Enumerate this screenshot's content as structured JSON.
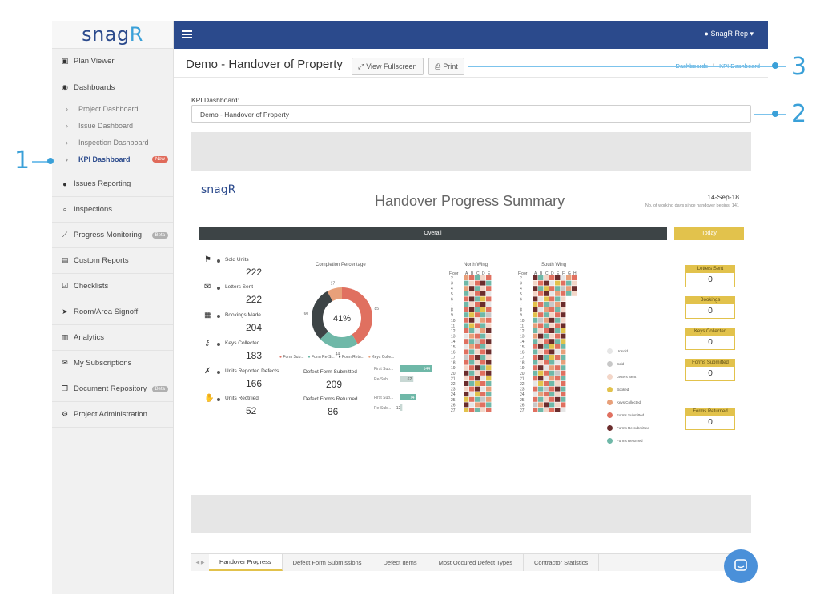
{
  "sidebar": {
    "logo_main": "snag",
    "logo_accent": "R",
    "items": [
      {
        "icon": "plan-viewer-icon",
        "label": "Plan Viewer"
      },
      {
        "icon": "dashboards-icon",
        "label": "Dashboards"
      },
      {
        "icon": "pin-icon",
        "label": "Issues Reporting"
      },
      {
        "icon": "search-icon",
        "label": "Inspections"
      },
      {
        "icon": "chart-line-icon",
        "label": "Progress Monitoring",
        "badge": "Beta"
      },
      {
        "icon": "document-icon",
        "label": "Custom Reports"
      },
      {
        "icon": "checkbox-icon",
        "label": "Checklists"
      },
      {
        "icon": "send-icon",
        "label": "Room/Area Signoff"
      },
      {
        "icon": "bar-chart-icon",
        "label": "Analytics"
      },
      {
        "icon": "envelope-icon",
        "label": "My Subscriptions"
      },
      {
        "icon": "files-icon",
        "label": "Document Repository",
        "badge": "Beta"
      },
      {
        "icon": "gears-icon",
        "label": "Project Administration"
      }
    ],
    "dashboard_sub": [
      {
        "label": "Project Dashboard"
      },
      {
        "label": "Issue Dashboard"
      },
      {
        "label": "Inspection Dashboard"
      },
      {
        "label": "KPI Dashboard",
        "badge": "New"
      }
    ]
  },
  "topbar": {
    "user": "SnagR Rep"
  },
  "header": {
    "title": "Demo - Handover of Property",
    "fullscreen_label": "View Fullscreen",
    "print_label": "Print",
    "breadcrumb": [
      "Dashboards",
      "KPI Dashboard"
    ]
  },
  "kpi": {
    "label": "KPI Dashboard:",
    "selected": "Demo - Handover of Property"
  },
  "report": {
    "logo": "snagR",
    "title": "Handover Progress Summary",
    "date": "14-Sep-18",
    "days_label": "No. of working days since handover begins: 141",
    "overall_label": "Overall",
    "today_label": "Today",
    "stats": [
      {
        "icon": "flag-icon",
        "label": "Sold Units",
        "value": "222"
      },
      {
        "icon": "envelope-icon",
        "label": "Letters Sent",
        "value": "222"
      },
      {
        "icon": "calendar-icon",
        "label": "Bookings Made",
        "value": "204"
      },
      {
        "icon": "key-icon",
        "label": "Keys Collected",
        "value": "183"
      },
      {
        "icon": "tools-icon",
        "label": "Units Reported Defects",
        "value": "166"
      },
      {
        "icon": "thumbs-up-icon",
        "label": "Units Rectified",
        "value": "52"
      }
    ],
    "donut": {
      "title": "Completion Percentage",
      "center": "41%",
      "segments": [
        {
          "name": "Form Sub...",
          "value": 85,
          "color": "#e07060"
        },
        {
          "name": "Form Re-S...",
          "value": 44,
          "color": "#6fb8a8"
        },
        {
          "name": "Form Retu...",
          "value": 60,
          "color": "#3d4446"
        },
        {
          "name": "Keys Colle...",
          "value": 17,
          "color": "#e8a07a"
        }
      ]
    },
    "defects_submitted": {
      "label": "Defect Form Submitted",
      "value": "209",
      "bars": [
        {
          "name": "First Sub...",
          "value": 144
        },
        {
          "name": "Re-Sub...",
          "value": 62
        }
      ]
    },
    "defects_returned": {
      "label": "Defect Forms Returned",
      "value": "86",
      "bars": [
        {
          "name": "First Sub...",
          "value": 74
        },
        {
          "name": "Re-Sub...",
          "value": 12
        }
      ]
    },
    "north_wing": {
      "title": "North Wing",
      "floor_label": "Floor",
      "cols": [
        "A",
        "B",
        "C",
        "D",
        "E"
      ]
    },
    "south_wing": {
      "title": "South Wing",
      "floor_label": "Floor",
      "cols": [
        "A",
        "B",
        "C",
        "D",
        "E",
        "F",
        "G",
        "H"
      ]
    },
    "floors": [
      "2",
      "3",
      "4",
      "5",
      "6",
      "7",
      "8",
      "9",
      "10",
      "11",
      "12",
      "13",
      "14",
      "15",
      "16",
      "17",
      "18",
      "19",
      "20",
      "21",
      "22",
      "23",
      "24",
      "25",
      "26",
      "27"
    ],
    "legend": [
      {
        "label": "Unsold",
        "color": "#e6e6e6"
      },
      {
        "label": "Sold",
        "color": "#c8c8c8"
      },
      {
        "label": "Letters Sent",
        "color": "#f3d6c8"
      },
      {
        "label": "Booked",
        "color": "#e2c24c"
      },
      {
        "label": "Keys Collected",
        "color": "#e8a07a"
      },
      {
        "label": "Forms Submitted",
        "color": "#e07060"
      },
      {
        "label": "Forms Re-submitted",
        "color": "#6b2d2d"
      },
      {
        "label": "Forms Returned",
        "color": "#6fb8a8"
      }
    ],
    "today_boxes": [
      {
        "label": "Letters Sent",
        "value": "0"
      },
      {
        "label": "Bookings",
        "value": "0"
      },
      {
        "label": "Keys Collected",
        "value": "0"
      },
      {
        "label": "Forms Submitted",
        "value": "0"
      },
      {
        "label": "Forms Returned",
        "value": "0"
      }
    ]
  },
  "tabs": [
    "Handover Progress",
    "Defect Form Submissions",
    "Defect Items",
    "Most Occured Defect Types",
    "Contractor Statistics"
  ],
  "callouts": [
    "1",
    "2",
    "3"
  ]
}
